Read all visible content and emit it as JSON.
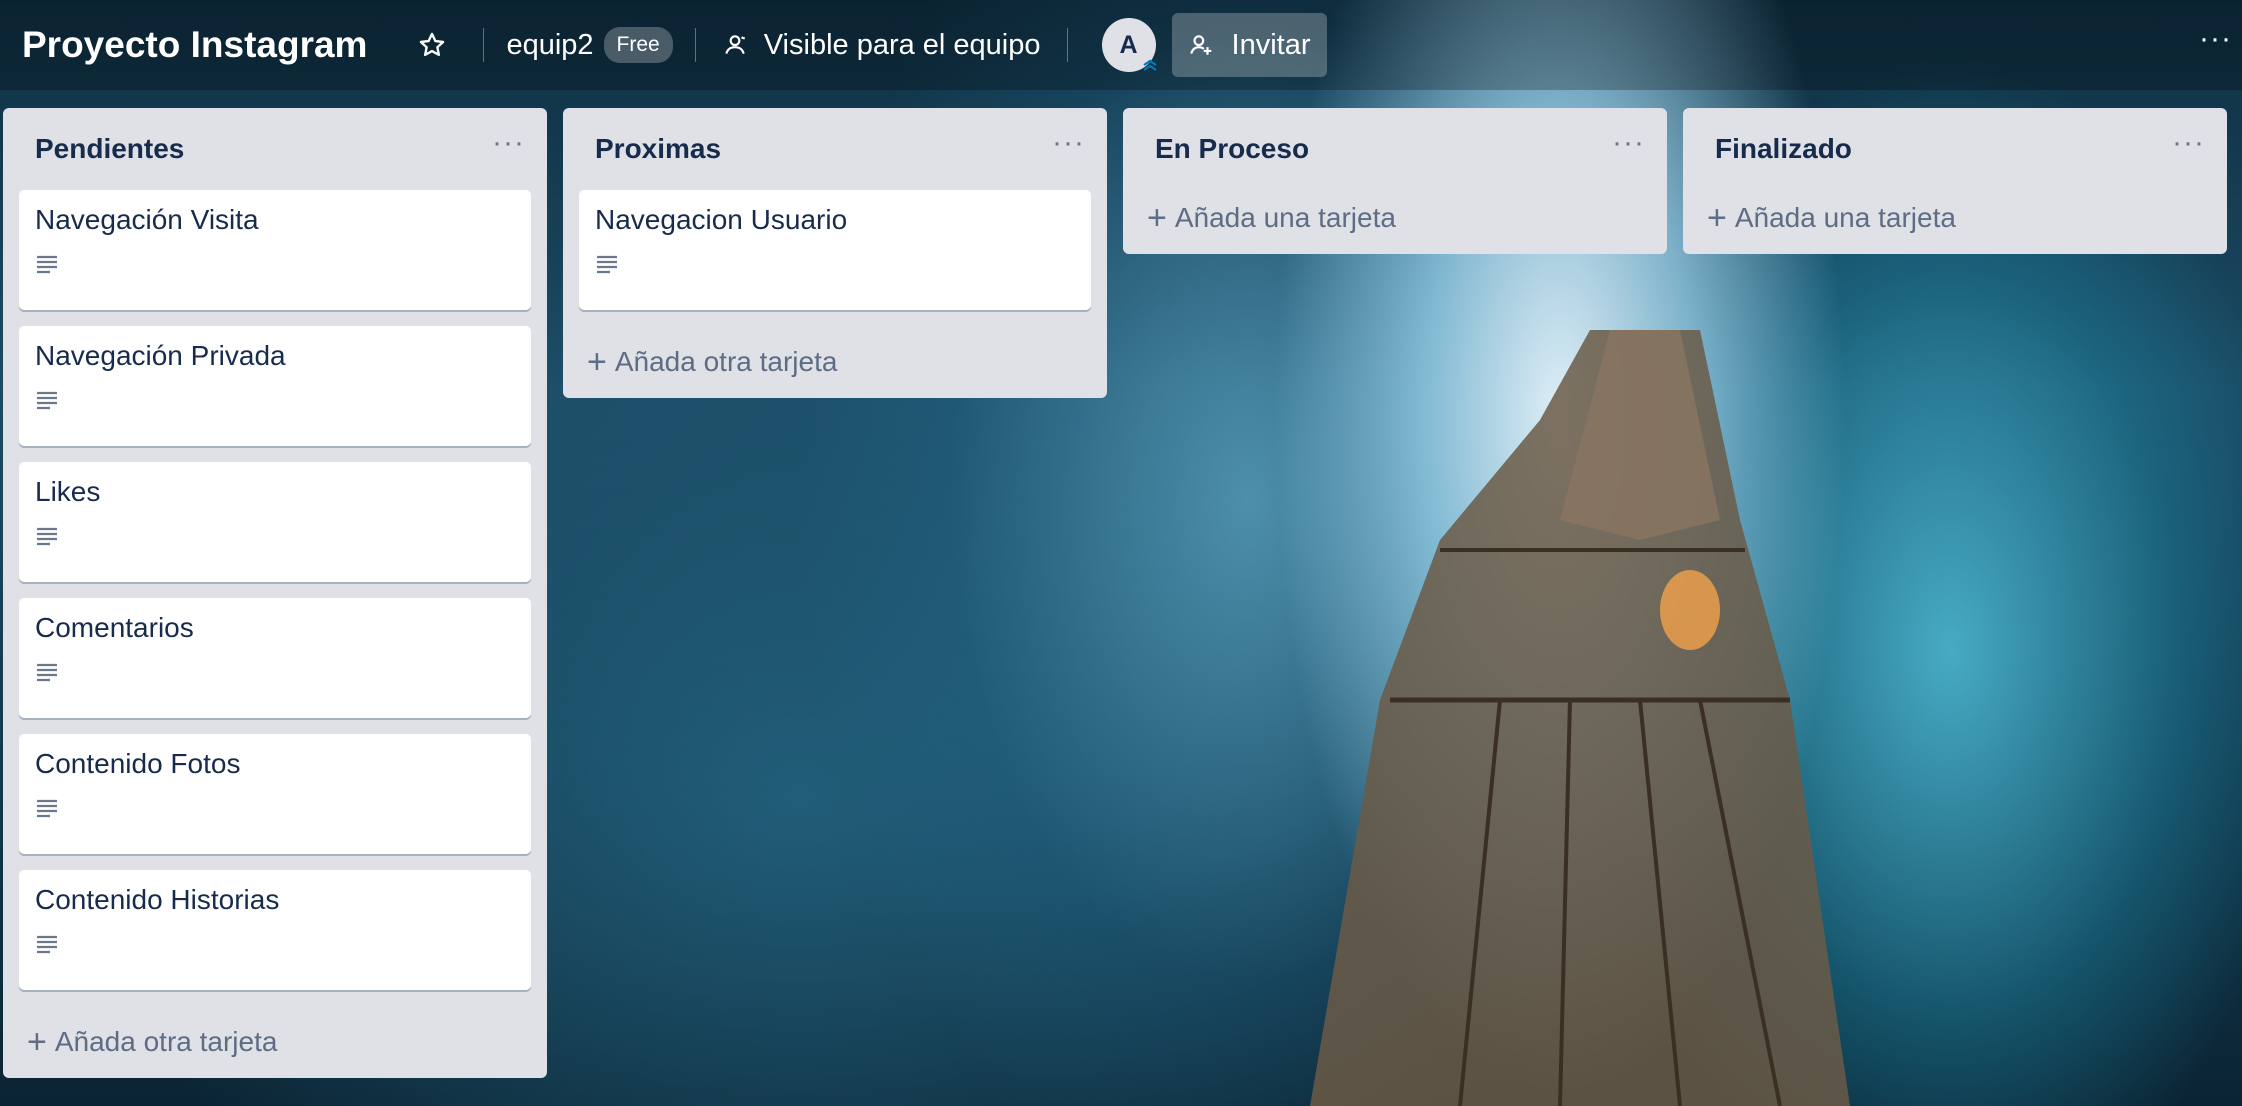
{
  "header": {
    "board_title": "Proyecto Instagram",
    "team_name": "equip2",
    "plan_badge": "Free",
    "visibility_label": "Visible para el equipo",
    "avatar_initial": "A",
    "invite_label": "Invitar",
    "more_label": "···"
  },
  "lists": [
    {
      "title": "Pendientes",
      "menu": "···",
      "cards": [
        {
          "title": "Navegación Visita"
        },
        {
          "title": "Navegación Privada"
        },
        {
          "title": "Likes"
        },
        {
          "title": "Comentarios"
        },
        {
          "title": "Contenido Fotos"
        },
        {
          "title": "Contenido Historias"
        }
      ],
      "add_label": "Añada otra tarjeta"
    },
    {
      "title": "Proximas",
      "menu": "···",
      "cards": [
        {
          "title": "Navegacion Usuario"
        }
      ],
      "add_label": "Añada otra tarjeta"
    },
    {
      "title": "En Proceso",
      "menu": "···",
      "cards": [],
      "add_label": "Añada una tarjeta"
    },
    {
      "title": "Finalizado",
      "menu": "···",
      "cards": [],
      "add_label": "Añada una tarjeta"
    }
  ],
  "icons": {
    "star": "star-icon",
    "visibility": "team-visibility-icon",
    "invite": "add-person-icon",
    "card_description": "description-icon"
  },
  "colors": {
    "list_bg": "#dfe1e6",
    "card_bg": "#ffffff",
    "text_primary": "#172b4d",
    "text_muted": "#5e6c84"
  }
}
